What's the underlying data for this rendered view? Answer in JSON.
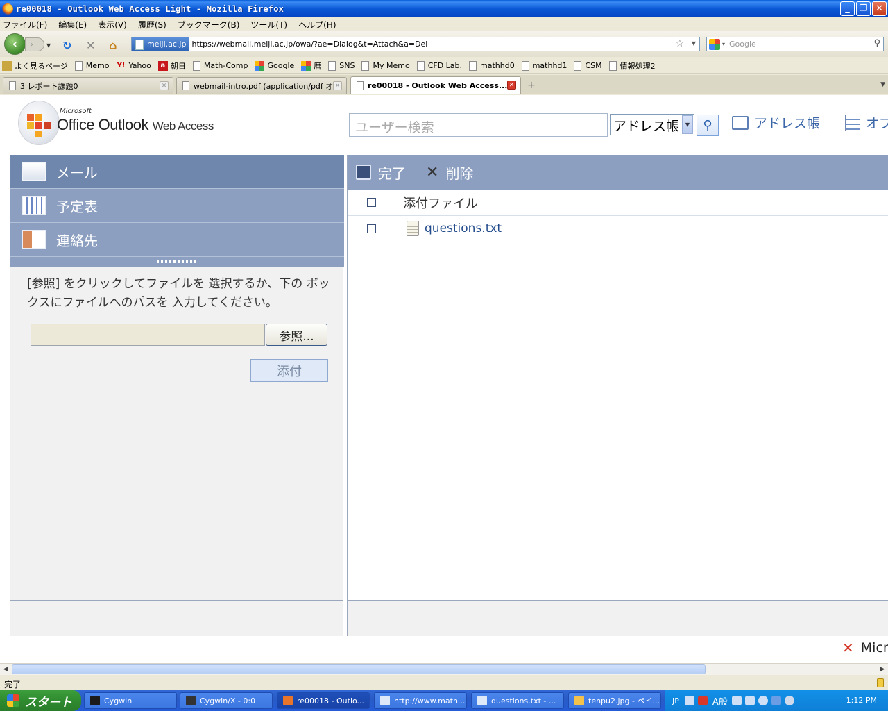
{
  "window": {
    "title": "re00018 - Outlook Web Access Light - Mozilla Firefox"
  },
  "menu": [
    "ファイル(F)",
    "編集(E)",
    "表示(V)",
    "履歴(S)",
    "ブックマーク(B)",
    "ツール(T)",
    "ヘルプ(H)"
  ],
  "address": {
    "site": "meiji.ac.jp",
    "url": "https://webmail.meiji.ac.jp/owa/?ae=Dialog&t=Attach&a=Del"
  },
  "search": {
    "placeholder": "Google"
  },
  "bookmarks": [
    "よく見るページ",
    "Memo",
    "Yahoo",
    "朝日",
    "Math-Comp",
    "Google",
    "暦",
    "SNS",
    "My Memo",
    "CFD Lab.",
    "mathhd0",
    "mathhd1",
    "CSM",
    "情報処理2"
  ],
  "tabs": [
    "3 レポート課題0",
    "webmail-intro.pdf (application/pdf オ...",
    "re00018 - Outlook Web Access..."
  ],
  "owa": {
    "microsoft": "Microsoft",
    "brand": "Office Outlook",
    "brand_sub": "Web Access",
    "user_search_placeholder": "ユーザー検索",
    "addr_select": "アドレス帳",
    "addr_link": "アドレス帳",
    "options_link": "オプ",
    "nav": {
      "mail": "メール",
      "calendar": "予定表",
      "contacts": "連絡先"
    },
    "instruction": "[参照] をクリックしてファイルを 選択するか、下の ボックスにファイルへのパスを 入力してください。",
    "browse": "参照...",
    "attach": "添付",
    "toolbar": {
      "done": "完了",
      "delete": "削除"
    },
    "col_header": "添付ファイル",
    "files": [
      "questions.txt"
    ],
    "footer_logo": "Micr"
  },
  "status": {
    "text": "完了"
  },
  "taskbar": {
    "start": "スタート",
    "tasks": [
      "Cygwin",
      "Cygwin/X - 0:0",
      "re00018 - Outlo...",
      "http://www.math...",
      "questions.txt - ...",
      "tenpu2.jpg - ペイ..."
    ],
    "tray_lang": "JP",
    "tray_ime": "A般",
    "clock": "1:12 PM"
  }
}
